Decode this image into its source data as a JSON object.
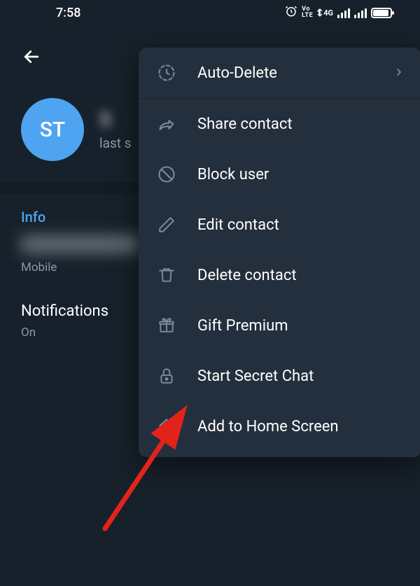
{
  "status": {
    "time": "7:58",
    "volte": "Vo\nLTE",
    "network": "4G"
  },
  "profile": {
    "avatar_initials": "ST",
    "name": "S",
    "status": "last s"
  },
  "info": {
    "title": "Info",
    "phone_label": "Mobile"
  },
  "notifications": {
    "title": "Notifications",
    "value": "On"
  },
  "menu": {
    "auto_delete": "Auto-Delete",
    "share_contact": "Share contact",
    "block_user": "Block user",
    "edit_contact": "Edit contact",
    "delete_contact": "Delete contact",
    "gift_premium": "Gift Premium",
    "start_secret_chat": "Start Secret Chat",
    "add_to_home": "Add to Home Screen"
  }
}
